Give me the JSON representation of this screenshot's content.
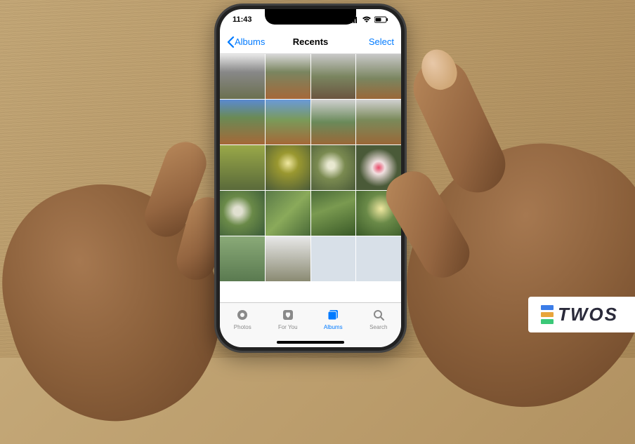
{
  "status": {
    "time": "11:43",
    "signal_icon": "signal-bars",
    "wifi_icon": "wifi",
    "battery_icon": "battery-half"
  },
  "nav": {
    "back_label": "Albums",
    "title": "Recents",
    "select_label": "Select"
  },
  "tabs": {
    "photos": "Photos",
    "foryou": "For You",
    "albums": "Albums",
    "search": "Search"
  },
  "watermark": {
    "text": "TWOS"
  }
}
